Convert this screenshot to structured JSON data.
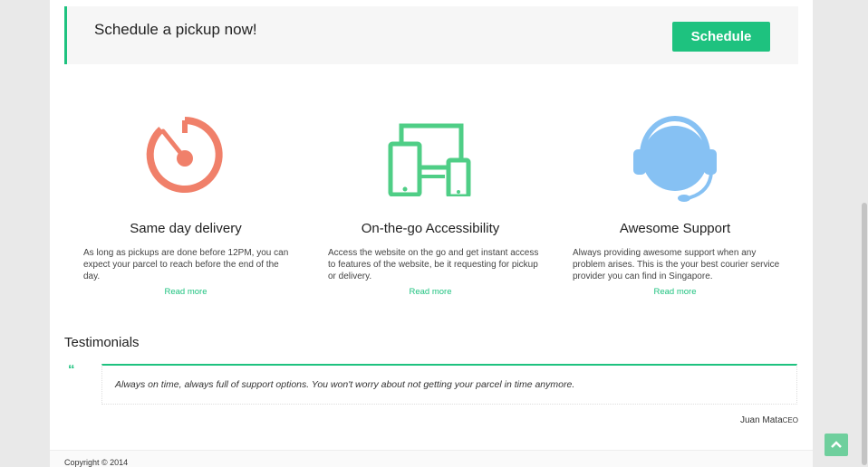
{
  "cta": {
    "text": "Schedule a pickup now!",
    "button": "Schedule"
  },
  "features": [
    {
      "title": "Same day delivery",
      "description": "As long as pickups are done before 12PM, you can expect your parcel to reach before the end of the day.",
      "link": "Read more",
      "icon": "stopwatch-icon",
      "color": "#f0806a"
    },
    {
      "title": "On-the-go Accessibility",
      "description": "Access the website on the go and get instant access to features of the website, be it requesting for pickup or delivery.",
      "link": "Read more",
      "icon": "devices-icon",
      "color": "#4fce86"
    },
    {
      "title": "Awesome Support",
      "description": "Always providing awesome support when any problem arises. This is the your best courier service provider you can find in Singapore.",
      "link": "Read more",
      "icon": "headset-icon",
      "color": "#86c1f3"
    }
  ],
  "testimonials": {
    "title": "Testimonials",
    "quote": "Always on time, always full of support options. You won't worry about not getting your parcel in time anymore.",
    "author": "Juan Mata",
    "role": "CEO"
  },
  "footer": {
    "copyright": "Copyright © 2014"
  },
  "colors": {
    "accent": "#1ec27f"
  }
}
